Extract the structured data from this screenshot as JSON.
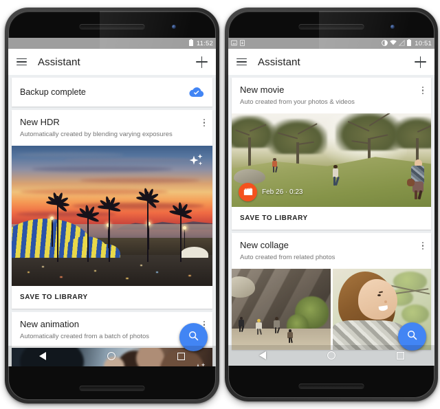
{
  "scene": {
    "description": "Two Android phones side by side showing the Google Photos Assistant screen"
  },
  "phone_left": {
    "status_bar": {
      "time": "11:52",
      "icons_right": [
        "battery-icon"
      ]
    },
    "app_bar": {
      "menu_icon": "hamburger-menu-icon",
      "title": "Assistant",
      "action_icon": "plus-icon"
    },
    "cards": [
      {
        "type": "status",
        "title": "Backup complete",
        "trailing_icon": "cloud-done-icon"
      },
      {
        "type": "suggestion",
        "title": "New HDR",
        "subtitle": "Automatically created by blending varying exposures",
        "overflow_icon": "more-vert-icon",
        "photo_alt": "Sunset over a beach boardwalk with palm trees and a blue-and-yellow circus tent",
        "photo_badge_icon": "sparkle-icon",
        "action_label": "SAVE TO LIBRARY"
      },
      {
        "type": "suggestion",
        "title": "New animation",
        "subtitle": "Automatically created from a batch of photos",
        "overflow_icon": "more-vert-icon",
        "photo_alt": "Dark action photo strip partially hidden behind the navigation bar"
      }
    ],
    "fab": {
      "icon": "search-icon",
      "color": "#4285f4"
    },
    "nav_bar": {
      "back_icon": "back-triangle-icon",
      "home_icon": "home-circle-icon",
      "recents_icon": "recents-square-icon"
    }
  },
  "phone_right": {
    "status_bar": {
      "time": "10:51",
      "icons_left": [
        "screenshot-icon",
        "download-icon"
      ],
      "icons_right": [
        "do-not-disturb-icon",
        "wifi-icon",
        "no-signal-icon",
        "battery-icon"
      ]
    },
    "app_bar": {
      "menu_icon": "hamburger-menu-icon",
      "title": "Assistant",
      "action_icon": "plus-icon"
    },
    "cards": [
      {
        "type": "suggestion",
        "title": "New movie",
        "subtitle": "Auto created from your photos & videos",
        "overflow_icon": "more-vert-icon",
        "photo_alt": "Three people hiking down a sunlit grassy hillside with oak trees",
        "video_badge": {
          "icon": "movie-icon",
          "icon_color": "#f4511e",
          "text": "Feb 26 · 0:23"
        },
        "action_label": "SAVE TO LIBRARY"
      },
      {
        "type": "suggestion",
        "title": "New collage",
        "subtitle": "Auto created from related photos",
        "overflow_icon": "more-vert-icon",
        "collage_alt": [
          "Hikers climbing a rocky canyon trail",
          "Smiling woman in a plaid shirt outdoors under a tree"
        ]
      }
    ],
    "fab": {
      "icon": "search-icon",
      "color": "#4285f4"
    },
    "nav_bar": {
      "back_icon": "back-triangle-icon",
      "home_icon": "home-circle-icon",
      "recents_icon": "recents-square-icon"
    }
  }
}
